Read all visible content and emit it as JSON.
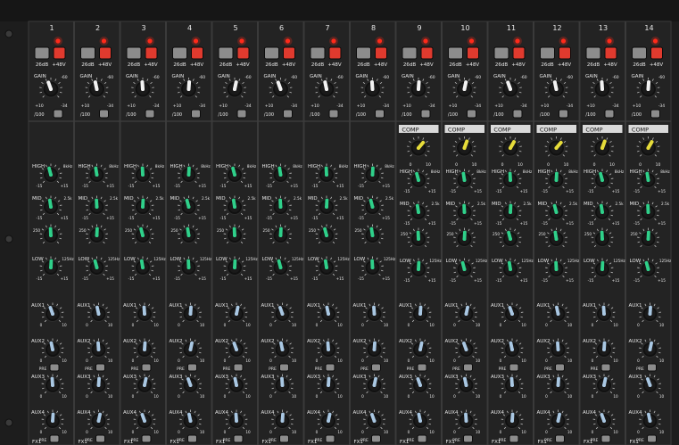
{
  "channels": [
    {
      "number": "1",
      "comp": false
    },
    {
      "number": "2",
      "comp": false
    },
    {
      "number": "3",
      "comp": false
    },
    {
      "number": "4",
      "comp": false
    },
    {
      "number": "5",
      "comp": false
    },
    {
      "number": "6",
      "comp": false
    },
    {
      "number": "7",
      "comp": false
    },
    {
      "number": "8",
      "comp": false
    },
    {
      "number": "9",
      "comp": true
    },
    {
      "number": "10",
      "comp": true
    },
    {
      "number": "11",
      "comp": true
    },
    {
      "number": "12",
      "comp": true
    },
    {
      "number": "13",
      "comp": true
    },
    {
      "number": "14",
      "comp": true
    }
  ],
  "labels": {
    "phantom": "+48V",
    "pad": "26dB",
    "gain": "GAIN",
    "gain_min": "+10",
    "gain_max": "-60",
    "gain_low": "-34",
    "hpf": "/100",
    "comp": "COMP",
    "comp_min": "0",
    "comp_max": "10",
    "high": "HIGH",
    "high_freq": "8kHz",
    "mid": "MID",
    "mid_lo": "250",
    "mid_hi": "2.5k",
    "low": "LOW",
    "low_freq": "125Hz",
    "eq_min": "-15",
    "eq_max": "+15",
    "aux1": "AUX1",
    "aux2": "AUX2",
    "aux3": "AUX3",
    "aux4": "AUX4",
    "fx1": "FX1",
    "pre": "PRE",
    "aux_min": "0",
    "aux_max": "10"
  },
  "colors": {
    "panel": "#232323",
    "panel_edge": "#3a3a3a",
    "knob": "#111111",
    "eq_cap": "#2fd08a",
    "aux_cap": "#a9c7e2",
    "gain_cap": "#f2f2f2",
    "comp_cap": "#e6dc3a",
    "led": "#ff2a1a",
    "button_gray": "#8c8c8c",
    "button_red": "#e03a2e"
  }
}
